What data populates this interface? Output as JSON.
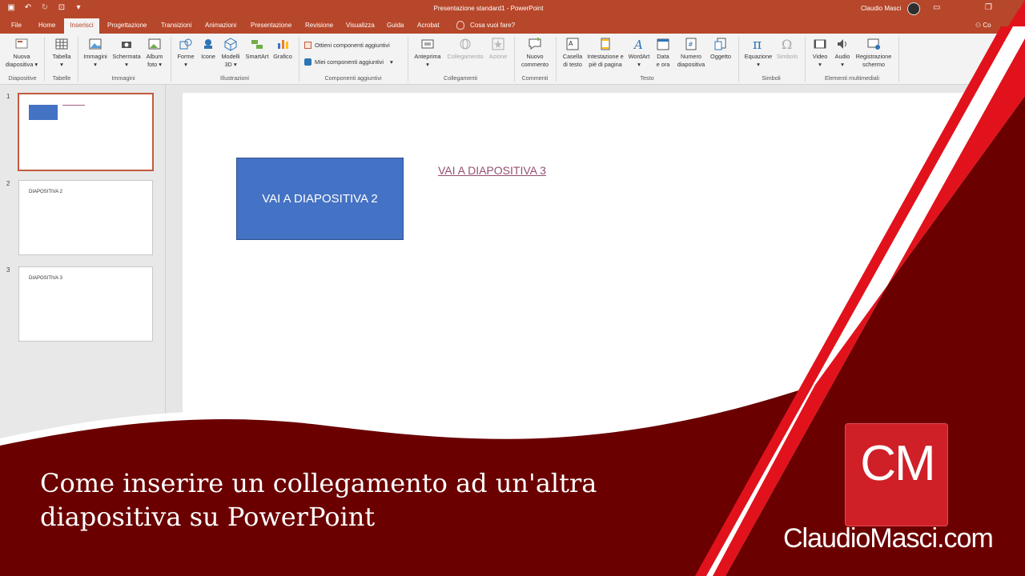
{
  "window": {
    "title": "Presentazione standard1  -  PowerPoint",
    "user": "Claudio Masci"
  },
  "tabs": [
    "File",
    "Home",
    "Inserisci",
    "Progettazione",
    "Transizioni",
    "Animazioni",
    "Presentazione",
    "Revisione",
    "Visualizza",
    "Guida",
    "Acrobat"
  ],
  "active_tab": "Inserisci",
  "tell_me": "Cosa vuoi fare?",
  "share": "Co",
  "ribbon": {
    "nuova_diapositiva": [
      "Nuova",
      "diapositiva ▾"
    ],
    "tabella": "Tabella",
    "immagini": "Immagini",
    "schermata": "Schermata",
    "album": [
      "Album",
      "foto ▾"
    ],
    "forme": "Forme",
    "icone": "Icone",
    "modelli": [
      "Modelli",
      "3D ▾"
    ],
    "smartart": "SmartArt",
    "grafico": "Grafico",
    "ottieni": "Ottieni componenti aggiuntivi",
    "miei": "Miei componenti aggiuntivi",
    "anteprima": "Anteprima",
    "collegamento": "Collegamento",
    "azione": "Azione",
    "nuovo_commento": [
      "Nuovo",
      "commento"
    ],
    "casella": [
      "Casella",
      "di testo"
    ],
    "intestazione": [
      "Intestazione e",
      "piè di pagina"
    ],
    "wordart": "WordArt",
    "data_ora": [
      "Data",
      "e ora"
    ],
    "numero": [
      "Numero",
      "diapositiva"
    ],
    "oggetto": "Oggetto",
    "equazione": "Equazione",
    "simbolo": "Simbolo",
    "video": "Video",
    "audio": "Audio",
    "registrazione": [
      "Registrazione",
      "schermo"
    ],
    "groups": {
      "diapositive": "Diapositive",
      "tabelle": "Tabelle",
      "immagini": "Immagini",
      "illustrazioni": "Illustrazioni",
      "componenti": "Componenti aggiuntivi",
      "collegamenti": "Collegamenti",
      "commenti": "Commenti",
      "testo": "Testo",
      "simboli": "Simboli",
      "multimediali": "Elementi multimediali"
    }
  },
  "thumbnails": [
    {
      "num": "1",
      "text": ""
    },
    {
      "num": "2",
      "text": "DIAPOSITIVA 2"
    },
    {
      "num": "3",
      "text": "DIAPOSITIVA 3"
    }
  ],
  "slide": {
    "button_text": "VAI A DIAPOSITIVA 2",
    "link_text": "VAI A DIAPOSITIVA 3"
  },
  "overlay": {
    "headline_line1": "Come inserire un collegamento ad un'altra",
    "headline_line2": "diapositiva su PowerPoint",
    "logo_letters": "CM",
    "site": "ClaudioMasci.com"
  },
  "colors": {
    "accent": "#b7472a",
    "shape_fill": "#4472c4",
    "link": "#954f72",
    "banner": "#6b0000",
    "stripe": "#e1121b",
    "logo": "#cf1f27"
  }
}
